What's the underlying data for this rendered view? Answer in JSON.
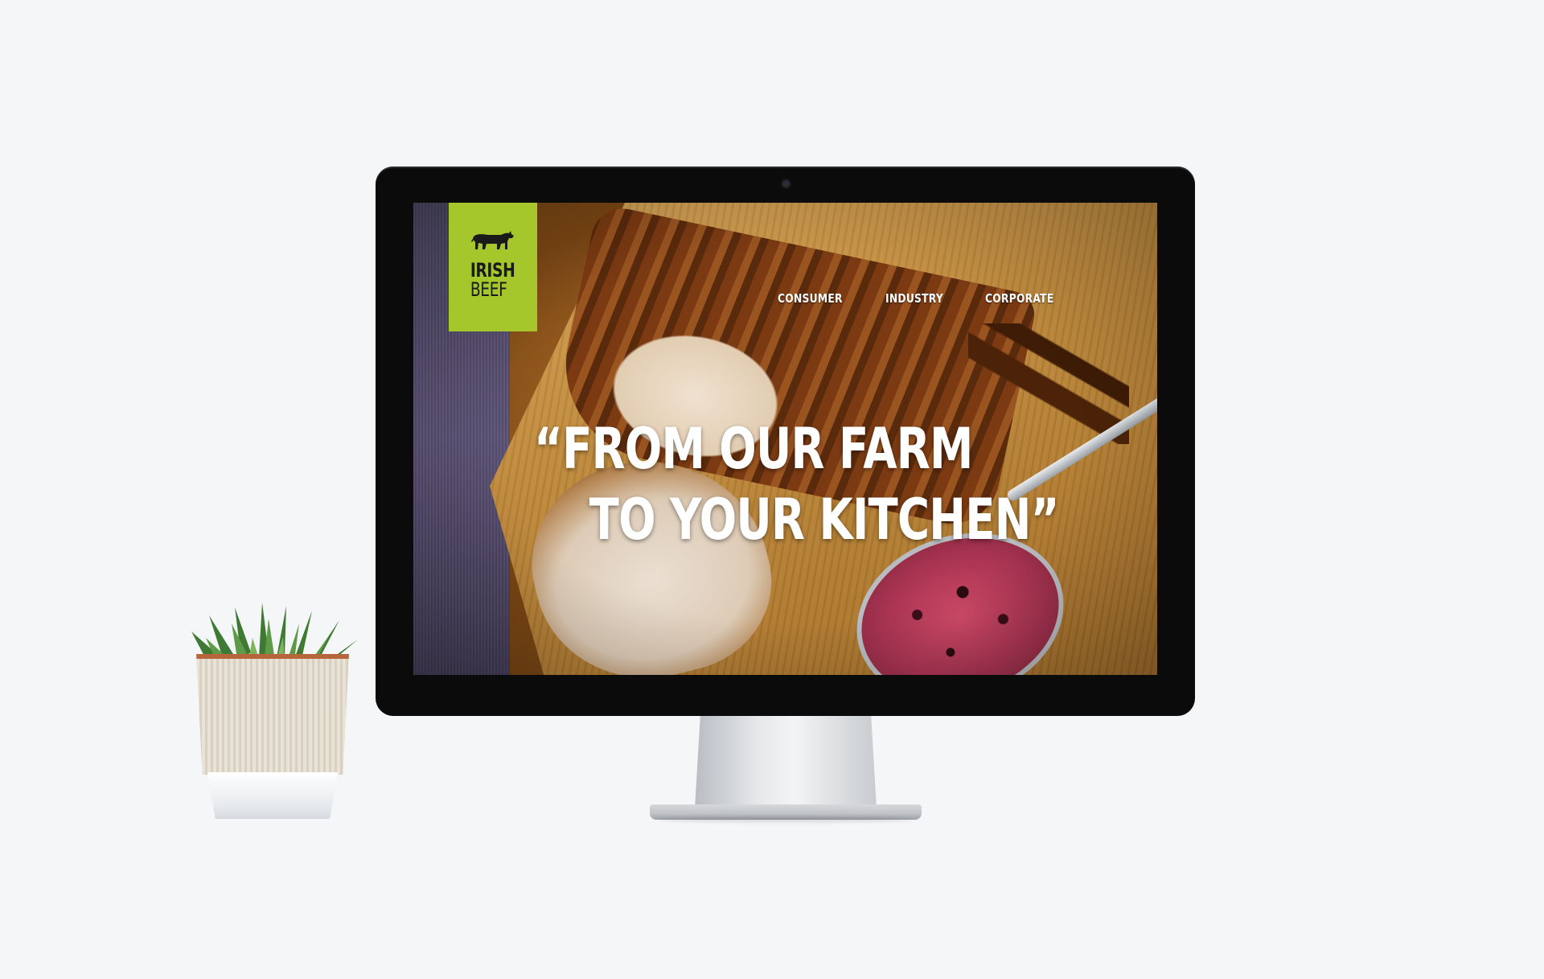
{
  "site": {
    "brand": {
      "line1": "IRISH",
      "line2": "BEEF",
      "icon": "cow-icon",
      "color": "#a5c72b"
    },
    "nav": {
      "items": [
        {
          "label": "CONSUMER"
        },
        {
          "label": "INDUSTRY"
        },
        {
          "label": "CORPORATE"
        }
      ]
    },
    "hero": {
      "headline_line1": "“FROM OUR FARM",
      "headline_line2": "TO YOUR KITCHEN”"
    }
  },
  "scene": {
    "background_color": "#f5f6f8",
    "device": "desktop monitor",
    "decor": "succulent-plant-in-pot"
  }
}
